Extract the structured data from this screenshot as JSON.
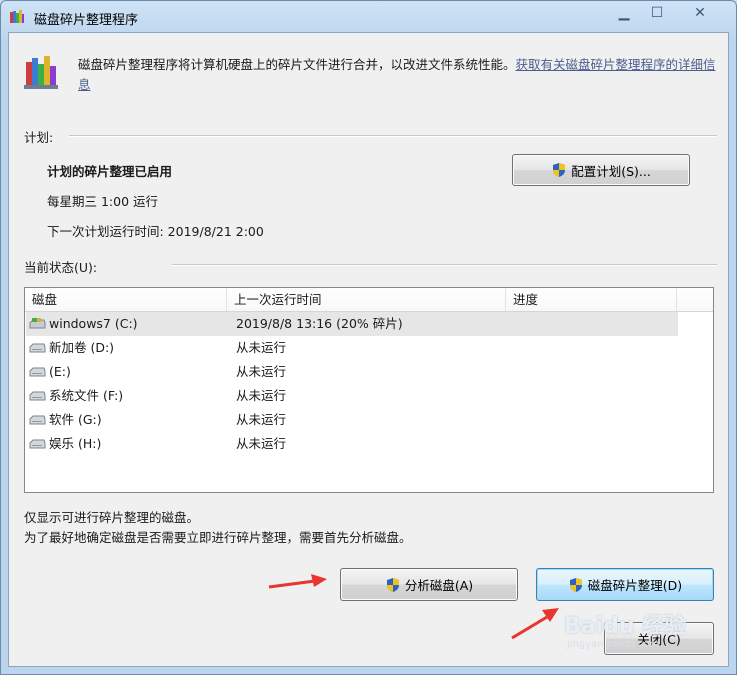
{
  "window": {
    "title": "磁盘碎片整理程序"
  },
  "intro": {
    "text": "磁盘碎片整理程序将计算机硬盘上的碎片文件进行合并，以改进文件系统性能。",
    "link": "获取有关磁盘碎片整理程序的详细信息"
  },
  "schedule": {
    "label": "计划:",
    "status": "计划的碎片整理已启用",
    "frequency": "每星期三  1:00 运行",
    "next_run": "下一次计划运行时间: 2019/8/21 2:00",
    "configure_button": "配置计划(S)..."
  },
  "current_status": {
    "label": "当前状态(U):",
    "columns": [
      "磁盘",
      "上一次运行时间",
      "进度"
    ],
    "rows": [
      {
        "disk": "windows7 (C:)",
        "last_run": "2019/8/8 13:16 (20% 碎片)",
        "progress": "",
        "icon": "system-drive-icon"
      },
      {
        "disk": "新加卷 (D:)",
        "last_run": "从未运行",
        "progress": "",
        "icon": "drive-icon"
      },
      {
        "disk": "(E:)",
        "last_run": "从未运行",
        "progress": "",
        "icon": "drive-icon"
      },
      {
        "disk": "系统文件 (F:)",
        "last_run": "从未运行",
        "progress": "",
        "icon": "drive-icon"
      },
      {
        "disk": "软件 (G:)",
        "last_run": "从未运行",
        "progress": "",
        "icon": "drive-icon"
      },
      {
        "disk": "娱乐 (H:)",
        "last_run": "从未运行",
        "progress": "",
        "icon": "drive-icon"
      }
    ]
  },
  "notes": {
    "line1": "仅显示可进行碎片整理的磁盘。",
    "line2": "为了最好地确定磁盘是否需要立即进行碎片整理，需要首先分析磁盘。"
  },
  "buttons": {
    "analyze": "分析磁盘(A)",
    "defragment": "磁盘碎片整理(D)",
    "close": "关闭(C)"
  },
  "watermark": {
    "text": "Baidu 经验",
    "sub": "jingyan.baidu.com"
  },
  "colors": {
    "arrow": "#e8352e",
    "link": "#4b5f8e"
  }
}
